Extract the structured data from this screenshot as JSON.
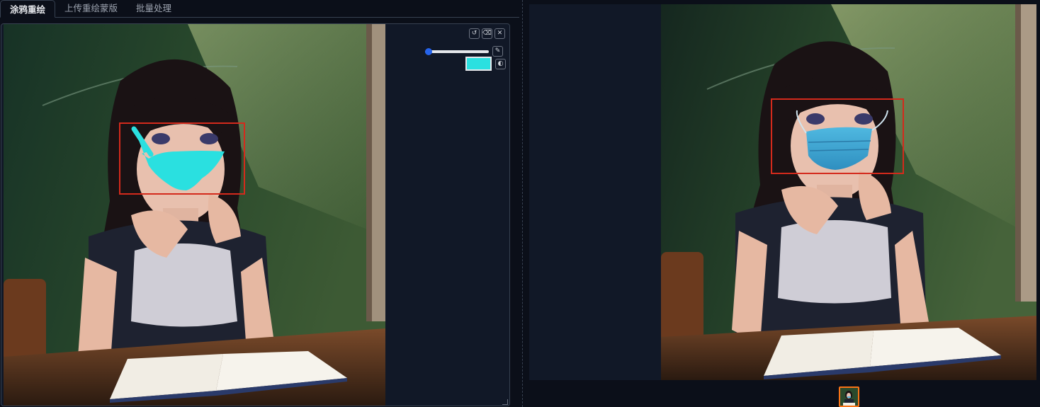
{
  "tabs": [
    {
      "label": "涂鸦重绘",
      "active": true
    },
    {
      "label": "上传重绘蒙版",
      "active": false
    },
    {
      "label": "批量处理",
      "active": false
    }
  ],
  "editor": {
    "tools": {
      "undo_icon": "undo-icon",
      "clear_icon": "eraser-icon",
      "close_icon": "close-icon",
      "brush_icon": "brush-icon",
      "palette_icon": "palette-icon"
    },
    "brush_size_level": 0.05,
    "brush_color": "#2ae0e0"
  },
  "output": {
    "thumbnail_selected": true,
    "highlight_color": "#f97316"
  },
  "colors": {
    "accent": "#2563eb",
    "mask": "#2ae0e0",
    "box": "#d42a1c",
    "background": "#0b0f19"
  }
}
